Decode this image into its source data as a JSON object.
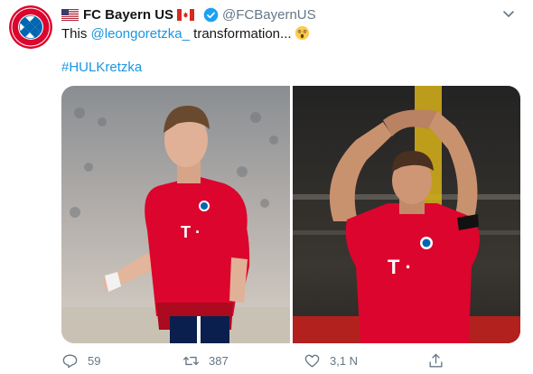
{
  "account": {
    "display_name": "FC Bayern US",
    "handle": "@FCBayernUS",
    "avatar_text_top": "FC BAYERN",
    "avatar_text_bottom": "MÜNCHEN"
  },
  "tweet": {
    "text_prefix": "This ",
    "mention": "@leongoretzka_",
    "text_suffix": " transformation...",
    "hashtag": "#HULKretzka",
    "left_shirt_sponsor": "T ·",
    "right_shirt_sponsor": "T ·"
  },
  "actions": {
    "reply_count": "59",
    "retweet_count": "387",
    "like_count": "3,1 N",
    "share_label": ""
  },
  "icons": [
    "us-flag-icon",
    "canada-flag-icon",
    "verified-badge-icon",
    "chevron-down-icon",
    "astonished-face-emoji-icon",
    "reply-icon",
    "retweet-icon",
    "like-icon",
    "share-icon"
  ],
  "colors": {
    "link": "#1b95e0",
    "muted": "#657786",
    "bayern_red": "#dc052d",
    "bayern_blue": "#0066b2"
  }
}
